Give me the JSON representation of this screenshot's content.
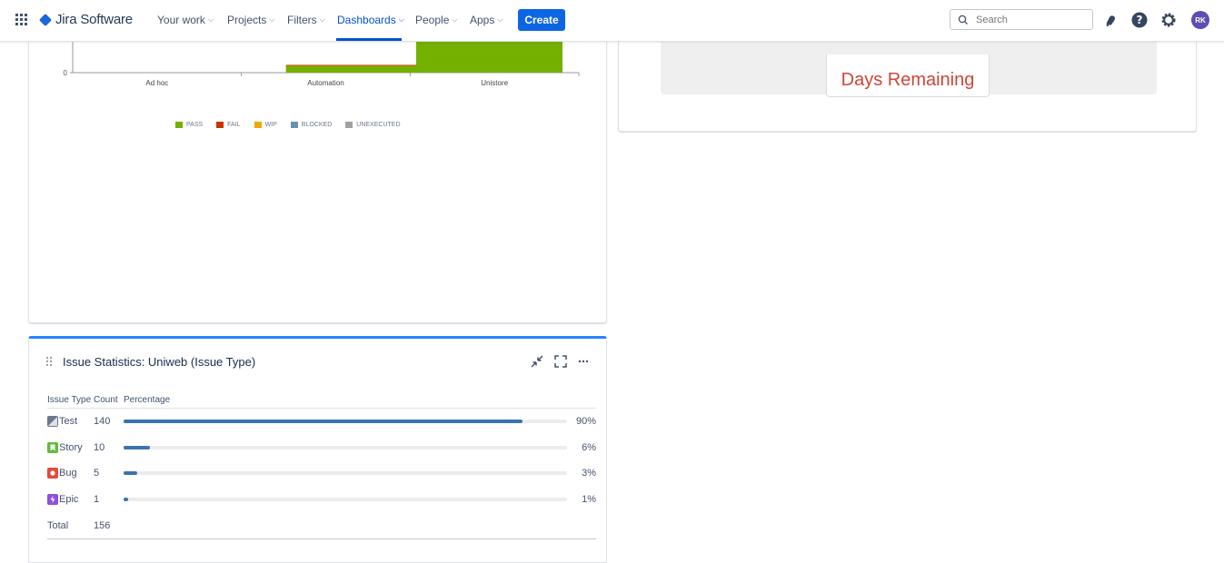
{
  "nav": {
    "logo": "Jira Software",
    "items": [
      {
        "label": "Your work",
        "key": "your-work"
      },
      {
        "label": "Projects",
        "key": "projects"
      },
      {
        "label": "Filters",
        "key": "filters"
      },
      {
        "label": "Dashboards",
        "key": "dashboards"
      },
      {
        "label": "People",
        "key": "people"
      },
      {
        "label": "Apps",
        "key": "apps"
      }
    ],
    "create_label": "Create",
    "search_placeholder": "Search",
    "avatar_initials": "RK",
    "accent_color": "#0052cc"
  },
  "chart_data": {
    "type": "bar",
    "stacked": true,
    "categories": [
      "Ad hoc",
      "Automation",
      "Unistore"
    ],
    "y_tick_labels": [
      "0"
    ],
    "series": [
      {
        "name": "PASS",
        "color": "#74b000",
        "values": [
          0,
          8,
          60
        ]
      },
      {
        "name": "FAIL",
        "color": "#cc3300",
        "values": [
          0,
          1,
          0
        ]
      },
      {
        "name": "WIP",
        "color": "#f0a800",
        "values": [
          0,
          0,
          0
        ]
      },
      {
        "name": "BLOCKED",
        "color": "#6693b0",
        "values": [
          0,
          0,
          0
        ]
      },
      {
        "name": "UNEXECUTED",
        "color": "#a0a0a0",
        "values": [
          0,
          0,
          0
        ]
      }
    ],
    "ylim": [
      0,
      60
    ],
    "legend_position": "bottom"
  },
  "countdown": {
    "label": "Days Remaining",
    "label_color": "#d04437"
  },
  "stats": {
    "title": "Issue Statistics: Uniweb (Issue Type)",
    "headers": {
      "type": "Issue Type",
      "count": "Count",
      "percentage": "Percentage"
    },
    "rows": [
      {
        "type": "Test",
        "count": "140",
        "percent": "90%",
        "fraction": 0.9,
        "icon": "test-icon"
      },
      {
        "type": "Story",
        "count": "10",
        "percent": "6%",
        "fraction": 0.06,
        "icon": "story-icon"
      },
      {
        "type": "Bug",
        "count": "5",
        "percent": "3%",
        "fraction": 0.03,
        "icon": "bug-icon"
      },
      {
        "type": "Epic",
        "count": "1",
        "percent": "1%",
        "fraction": 0.01,
        "icon": "epic-icon"
      }
    ],
    "total_label": "Total",
    "total_count": "156",
    "bar_color": "#3b73af"
  }
}
